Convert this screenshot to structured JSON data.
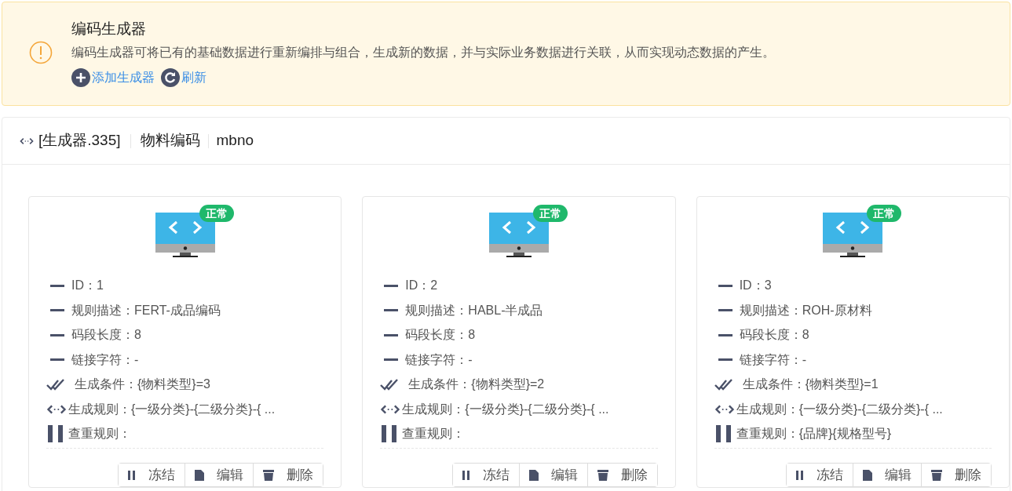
{
  "alert": {
    "title": "编码生成器",
    "description": "编码生成器可将已有的基础数据进行重新编排与组合，生成新的数据，并与实际业务数据进行关联，从而实现动态数据的产生。",
    "actions": [
      {
        "kind": "add",
        "label": "添加生成器"
      },
      {
        "kind": "refresh",
        "label": "刷新"
      }
    ]
  },
  "panel": {
    "title": "[生成器.335]",
    "name": "物料编码",
    "code": "mbno"
  },
  "cards": [
    {
      "status": "正常",
      "rows": [
        {
          "kind": "dash",
          "text": "ID：1"
        },
        {
          "kind": "dash",
          "text": "规则描述：FERT-成品编码"
        },
        {
          "kind": "dash",
          "text": "码段长度：8"
        },
        {
          "kind": "dash",
          "text": "链接字符：-"
        },
        {
          "kind": "check",
          "text": "生成条件：{物料类型}=3"
        },
        {
          "kind": "code",
          "text": "生成规则：{一级分类}-{二级分类}-{ ..."
        },
        {
          "kind": "bars",
          "text": "查重规则："
        }
      ],
      "buttons": [
        {
          "kind": "pause",
          "label": "冻结"
        },
        {
          "kind": "edit",
          "label": "编辑"
        },
        {
          "kind": "delete",
          "label": "删除"
        }
      ]
    },
    {
      "status": "正常",
      "rows": [
        {
          "kind": "dash",
          "text": "ID：2"
        },
        {
          "kind": "dash",
          "text": "规则描述：HABL-半成品"
        },
        {
          "kind": "dash",
          "text": "码段长度：8"
        },
        {
          "kind": "dash",
          "text": "链接字符：-"
        },
        {
          "kind": "check",
          "text": "生成条件：{物料类型}=2"
        },
        {
          "kind": "code",
          "text": "生成规则：{一级分类}-{二级分类}-{ ..."
        },
        {
          "kind": "bars",
          "text": "查重规则："
        }
      ],
      "buttons": [
        {
          "kind": "pause",
          "label": "冻结"
        },
        {
          "kind": "edit",
          "label": "编辑"
        },
        {
          "kind": "delete",
          "label": "删除"
        }
      ]
    },
    {
      "status": "正常",
      "rows": [
        {
          "kind": "dash",
          "text": "ID：3"
        },
        {
          "kind": "dash",
          "text": "规则描述：ROH-原材料"
        },
        {
          "kind": "dash",
          "text": "码段长度：8"
        },
        {
          "kind": "dash",
          "text": "链接字符：-"
        },
        {
          "kind": "check",
          "text": "生成条件：{物料类型}=1"
        },
        {
          "kind": "code",
          "text": "生成规则：{一级分类}-{二级分类}-{ ..."
        },
        {
          "kind": "bars",
          "text": "查重规则：{品牌}{规格型号}"
        }
      ],
      "buttons": [
        {
          "kind": "pause",
          "label": "冻结"
        },
        {
          "kind": "edit",
          "label": "编辑"
        },
        {
          "kind": "delete",
          "label": "删除"
        }
      ]
    }
  ]
}
